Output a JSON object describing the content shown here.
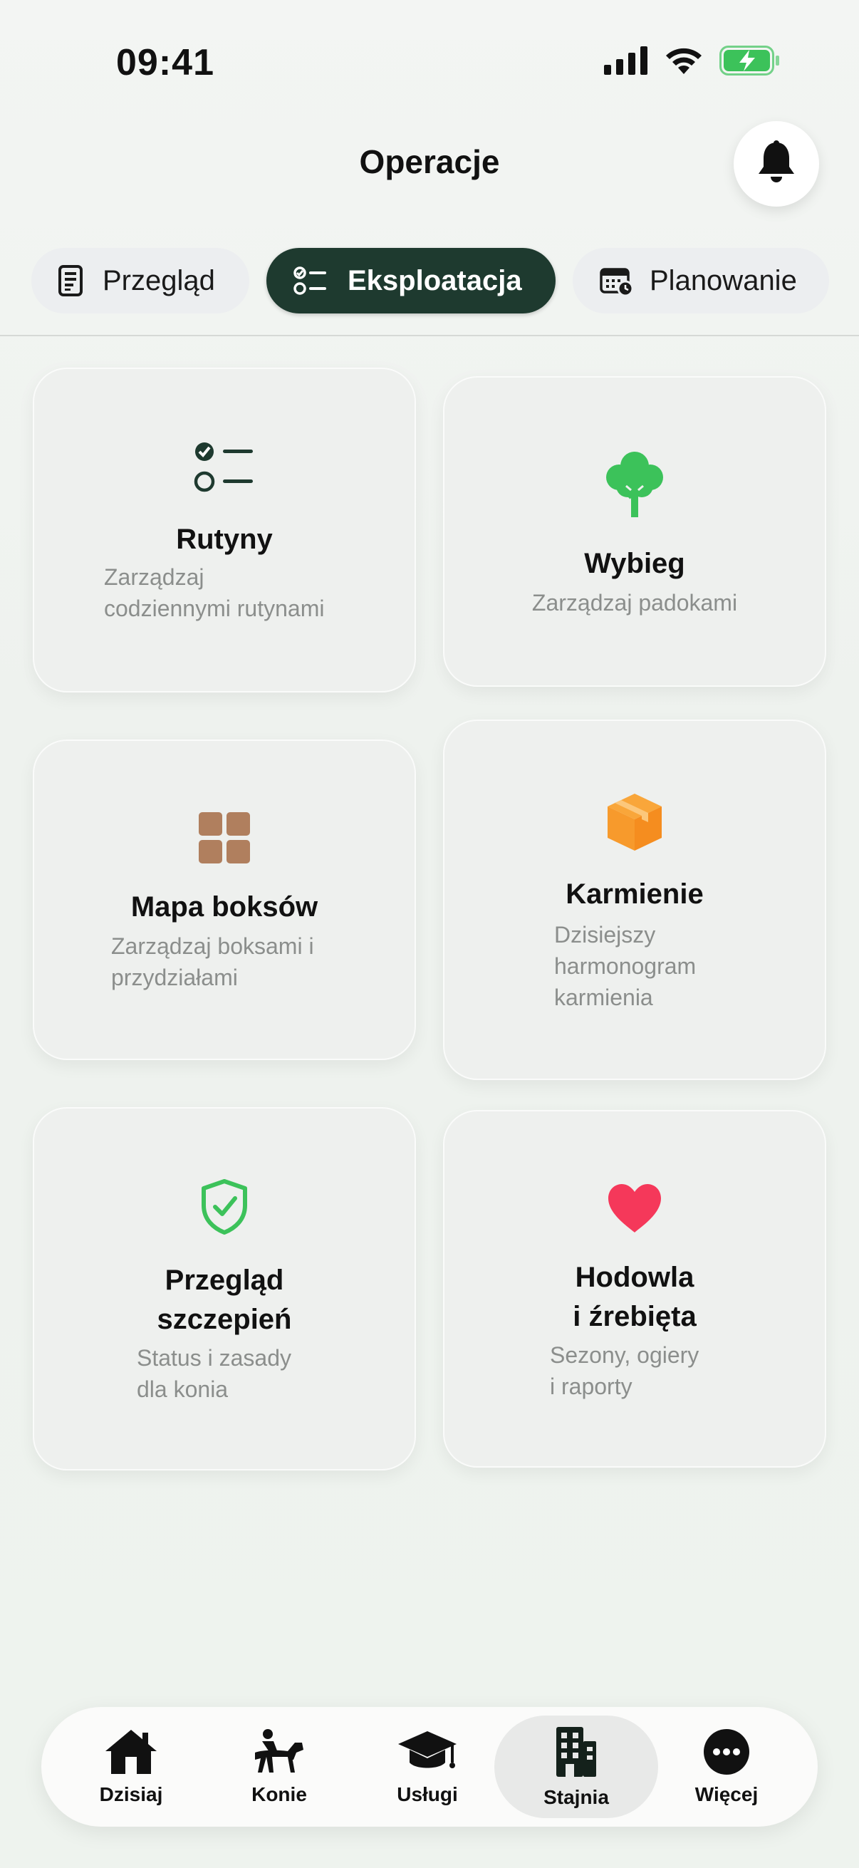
{
  "status_bar": {
    "time": "09:41",
    "icons": [
      "signal-icon",
      "wifi-icon",
      "battery-charging-icon"
    ]
  },
  "header": {
    "title": "Operacje",
    "bell_icon": "bell-icon"
  },
  "tabs": [
    {
      "label": "Przegląd",
      "icon": "document-icon"
    },
    {
      "label": "Eksploatacja",
      "icon": "checklist-icon",
      "active": true
    },
    {
      "label": "Planowanie",
      "icon": "calendar-clock-icon"
    }
  ],
  "cards": [
    {
      "title": "Rutyny",
      "subtitle_lines": [
        "Zarządzaj",
        "codziennymi rutynami"
      ],
      "icon": "checklist-icon"
    },
    {
      "title": "Wybieg",
      "subtitle_lines": [
        "Zarządzaj padokami"
      ],
      "icon": "tree-icon",
      "color": "#3cc25a"
    },
    {
      "title": "Mapa boksów",
      "subtitle_lines": [
        "Zarządzaj boksami i",
        "przydziałami"
      ],
      "icon": "grid-icon",
      "color": "#b07f5e"
    },
    {
      "title": "Karmienie",
      "subtitle_lines": [
        "Dzisiejszy",
        "harmonogram",
        "karmienia"
      ],
      "icon": "box-icon",
      "color": "#f79a2c"
    },
    {
      "title_lines": [
        "Przegląd",
        "szczepień"
      ],
      "subtitle_lines": [
        "Status i zasady",
        "dla konia"
      ],
      "icon": "shield-check-icon",
      "color": "#3cc25a"
    },
    {
      "title_lines": [
        "Hodowla",
        "i źrebięta"
      ],
      "subtitle_lines": [
        "Sezony, ogiery",
        "i raporty"
      ],
      "icon": "heart-icon",
      "color": "#f5385a"
    }
  ],
  "bottom_nav": [
    {
      "label": "Dzisiaj",
      "icon": "home-icon"
    },
    {
      "label": "Konie",
      "icon": "horse-rider-icon"
    },
    {
      "label": "Usługi",
      "icon": "graduation-cap-icon"
    },
    {
      "label": "Stajnia",
      "icon": "building-icon",
      "active": true
    },
    {
      "label": "Więcej",
      "icon": "more-icon"
    }
  ],
  "colors": {
    "active_tab": "#1e3a2f",
    "background": "#eef2ee",
    "subtitle": "#8b8e8c"
  }
}
